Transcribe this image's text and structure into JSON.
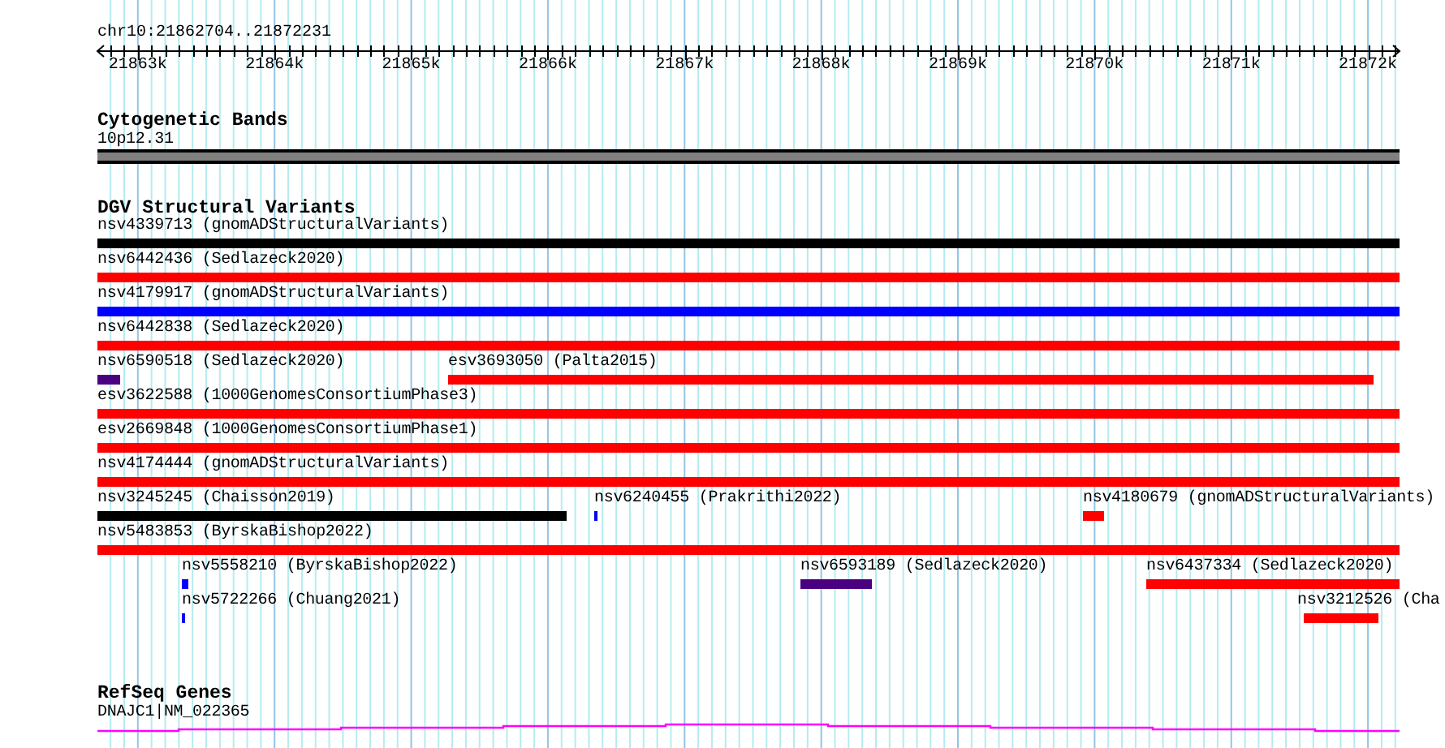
{
  "ruler": {
    "location": "chr10:21862704..21872231",
    "ticks": [
      "21863k",
      "21864k",
      "21865k",
      "21866k",
      "21867k",
      "21868k",
      "21869k",
      "21870k",
      "21871k",
      "21872k"
    ]
  },
  "tracks": [
    {
      "title": "Cytogenetic Bands",
      "kind": "bands",
      "features": [
        {
          "label": "10p12.31",
          "color": "#808080"
        }
      ]
    },
    {
      "title": "DGV Structural Variants",
      "kind": "variants",
      "features": [
        {
          "label": "nsv4339713 (gnomADStructuralVariants)",
          "color": "#000000"
        },
        {
          "label": "nsv6442436 (Sedlazeck2020)",
          "color": "#ff0000"
        },
        {
          "label": "nsv4179917 (gnomADStructuralVariants)",
          "color": "#0000ff"
        },
        {
          "label": "nsv6442838 (Sedlazeck2020)",
          "color": "#ff0000"
        },
        {
          "label": "nsv6590518 (Sedlazeck2020)",
          "color": "#4b0082"
        },
        {
          "label": "esv3693050 (Palta2015)",
          "color": "#ff0000"
        },
        {
          "label": "esv3622588 (1000GenomesConsortiumPhase3)",
          "color": "#ff0000"
        },
        {
          "label": "esv2669848 (1000GenomesConsortiumPhase1)",
          "color": "#ff0000"
        },
        {
          "label": "nsv4174444 (gnomADStructuralVariants)",
          "color": "#ff0000"
        },
        {
          "label": "nsv3245245 (Chaisson2019)",
          "color": "#000000"
        },
        {
          "label": "nsv6240455 (Prakrithi2022)",
          "color": "#0000ff"
        },
        {
          "label": "nsv4180679 (gnomADStructuralVariants)",
          "color": "#ff0000"
        },
        {
          "label": "nsv5483853 (ByrskaBishop2022)",
          "color": "#ff0000"
        },
        {
          "label": "nsv5558210 (ByrskaBishop2022)",
          "color": "#0000ff"
        },
        {
          "label": "nsv6593189 (Sedlazeck2020)",
          "color": "#4b0082"
        },
        {
          "label": "nsv6437334 (Sedlazeck2020)",
          "color": "#ff0000"
        },
        {
          "label": "nsv5722266 (Chuang2021)",
          "color": "#0000ff"
        },
        {
          "label": "nsv3212526 (Cha",
          "color": "#ff0000"
        }
      ]
    },
    {
      "title": "RefSeq Genes",
      "kind": "genes",
      "features": [
        {
          "label": "DNAJC1|NM_022365",
          "color": "#ff00ff"
        }
      ]
    }
  ]
}
